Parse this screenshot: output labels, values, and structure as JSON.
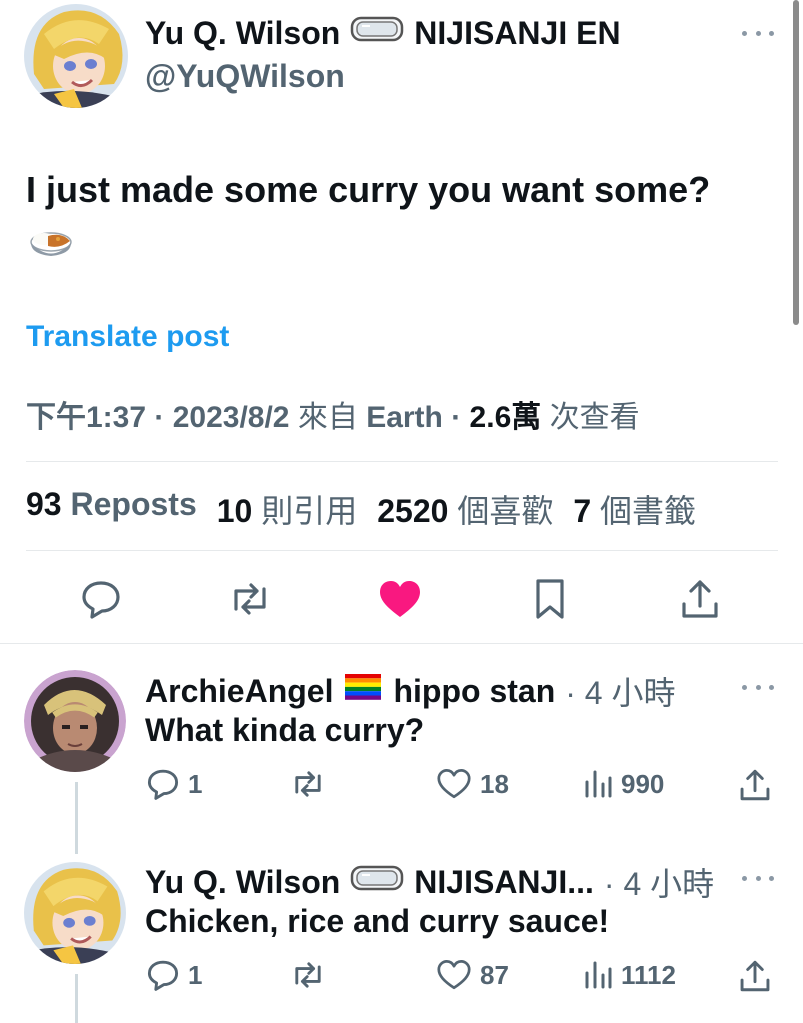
{
  "main_post": {
    "author_name": "Yu Q. Wilson",
    "author_suffix": "NIJISANJI EN",
    "handle": "@YuQWilson",
    "text": "I just made some curry you want some?",
    "emoji_icon": "curry-rice-icon",
    "translate_label": "Translate post",
    "time": "下午1:37",
    "date": "2023/8/2",
    "source_prefix": "來自",
    "source": "Earth",
    "views": "2.6萬",
    "views_label": "次查看",
    "stats": {
      "reposts_count": "93",
      "reposts_label": "Reposts",
      "quotes_count": "10",
      "quotes_label": "則引用",
      "likes_count": "2520",
      "likes_label": "個喜歡",
      "bookmarks_count": "7",
      "bookmarks_label": "個書籤"
    },
    "like_color": "#f91880"
  },
  "replies": [
    {
      "author_name": "ArchieAngel",
      "author_suffix": "hippo stan",
      "time": "4 小時",
      "text": "What kinda curry?",
      "reply_count": "1",
      "repost_count": "",
      "like_count": "18",
      "view_count": "990"
    },
    {
      "author_name": "Yu Q. Wilson",
      "author_suffix": "NIJISANJI...",
      "time": "4 小時",
      "text": "Chicken, rice and curry sauce!",
      "reply_count": "1",
      "repost_count": "",
      "like_count": "87",
      "view_count": "1112"
    }
  ],
  "colors": {
    "accent": "#1d9bf0",
    "secondary_text": "#536471",
    "primary_text": "#0f1419"
  }
}
